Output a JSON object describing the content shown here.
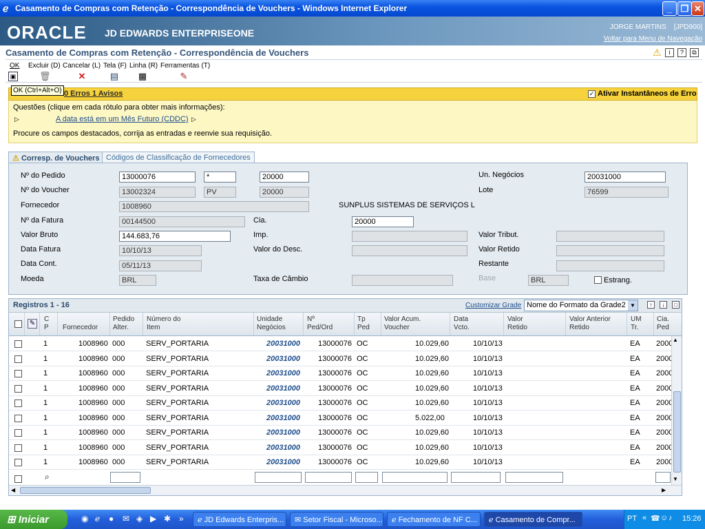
{
  "window": {
    "title": "Casamento de Compras com Retenção - Correspondência de Vouchers - Windows Internet Explorer"
  },
  "header": {
    "brand": "ORACLE",
    "product": "JD EDWARDS ENTERPRISEONE",
    "user": "JORGE MARTINS",
    "env": "[JPD900]",
    "back_link": "Voltar para Menu de Navegação"
  },
  "form": {
    "title": "Casamento de Compras com Retenção - Correspondência de Vouchers"
  },
  "toolbar": {
    "ok": "OK",
    "excluir": "Excluir (D)",
    "cancelar": "Cancelar (L)",
    "tela": "Tela (F)",
    "linha": "Linha (R)",
    "ferramentas": "Ferramentas (T)",
    "tooltip": "OK (Ctrl+Alt+O)"
  },
  "errors": {
    "summary": "0 Erros 1 Avisos",
    "toggle_label": "Ativar Instantâneos de Erro",
    "questions": "Questões (clique em cada rótulo para obter mais informações):",
    "warning_link": "A data está em um Mês Futuro (CDDC)",
    "instruction": "Procure os campos destacados, corrija as entradas e reenvie sua requisição."
  },
  "tabs": [
    {
      "label": "Corresp. de Vouchers"
    },
    {
      "label": "Códigos de Classificação de Fornecedores"
    }
  ],
  "fields": {
    "pedido_label": "Nº do Pedido",
    "pedido_num": "13000076",
    "pedido_tipo": "*",
    "pedido_cia": "20000",
    "voucher_label": "Nº do Voucher",
    "voucher_num": "13002324",
    "voucher_tipo": "PV",
    "voucher_cia": "20000",
    "fornecedor_label": "Fornecedor",
    "fornecedor": "1008960",
    "fornecedor_nome": "SUNPLUS SISTEMAS DE SERVIÇOS L",
    "fatura_label": "Nº da Fatura",
    "fatura": "00144500",
    "cia_label": "Cia.",
    "cia": "20000",
    "valor_bruto_label": "Valor Bruto",
    "valor_bruto": "144.683,76",
    "imp_label": "Imp.",
    "data_fatura_label": "Data Fatura",
    "data_fatura": "10/10/13",
    "valor_desc_label": "Valor do Desc.",
    "data_cont_label": "Data Cont.",
    "data_cont": "05/11/13",
    "moeda_label": "Moeda",
    "moeda": "BRL",
    "taxa_label": "Taxa de Câmbio",
    "un_negocios_label": "Un. Negócios",
    "un_negocios": "20031000",
    "lote_label": "Lote",
    "lote": "76599",
    "valor_tribut_label": "Valor Tribut.",
    "valor_retido_label": "Valor Retido",
    "restante_label": "Restante",
    "base_label": "Base",
    "base": "BRL",
    "estrang_label": "Estrang."
  },
  "grid": {
    "records": "Registros 1 - 16",
    "customize": "Customizar Grade",
    "format": "Nome do Formato da Grade2",
    "columns": [
      "C\nP",
      "Fornecedor",
      "Pedido\nAlter.",
      "Número do\nItem",
      "Unidade\nNegócios",
      "Nº\nPed/Ord",
      "Tp\nPed",
      "Valor Acum.\nVoucher",
      "Data\nVcto.",
      "Valor\nRetido",
      "Valor Anterior\nRetido",
      "UM\nTr.",
      "Cia.\nPed"
    ],
    "rows": [
      {
        "cp": "1",
        "fornecedor": "1008960",
        "pedido_alter": "000",
        "item": "SERV_PORTARIA",
        "unidade": "20031000",
        "ped_ord": "13000076",
        "tp": "OC",
        "valor": "10.029,60",
        "data": "10/10/13",
        "um": "EA",
        "cia": "2000"
      },
      {
        "cp": "1",
        "fornecedor": "1008960",
        "pedido_alter": "000",
        "item": "SERV_PORTARIA",
        "unidade": "20031000",
        "ped_ord": "13000076",
        "tp": "OC",
        "valor": "10.029,60",
        "data": "10/10/13",
        "um": "EA",
        "cia": "2000"
      },
      {
        "cp": "1",
        "fornecedor": "1008960",
        "pedido_alter": "000",
        "item": "SERV_PORTARIA",
        "unidade": "20031000",
        "ped_ord": "13000076",
        "tp": "OC",
        "valor": "10.029,60",
        "data": "10/10/13",
        "um": "EA",
        "cia": "2000"
      },
      {
        "cp": "1",
        "fornecedor": "1008960",
        "pedido_alter": "000",
        "item": "SERV_PORTARIA",
        "unidade": "20031000",
        "ped_ord": "13000076",
        "tp": "OC",
        "valor": "10.029,60",
        "data": "10/10/13",
        "um": "EA",
        "cia": "2000"
      },
      {
        "cp": "1",
        "fornecedor": "1008960",
        "pedido_alter": "000",
        "item": "SERV_PORTARIA",
        "unidade": "20031000",
        "ped_ord": "13000076",
        "tp": "OC",
        "valor": "10.029,60",
        "data": "10/10/13",
        "um": "EA",
        "cia": "2000"
      },
      {
        "cp": "1",
        "fornecedor": "1008960",
        "pedido_alter": "000",
        "item": "SERV_PORTARIA",
        "unidade": "20031000",
        "ped_ord": "13000076",
        "tp": "OC",
        "valor": "5.022,00",
        "data": "10/10/13",
        "um": "EA",
        "cia": "2000"
      },
      {
        "cp": "1",
        "fornecedor": "1008960",
        "pedido_alter": "000",
        "item": "SERV_PORTARIA",
        "unidade": "20031000",
        "ped_ord": "13000076",
        "tp": "OC",
        "valor": "10.029,60",
        "data": "10/10/13",
        "um": "EA",
        "cia": "2000"
      },
      {
        "cp": "1",
        "fornecedor": "1008960",
        "pedido_alter": "000",
        "item": "SERV_PORTARIA",
        "unidade": "20031000",
        "ped_ord": "13000076",
        "tp": "OC",
        "valor": "10.029,60",
        "data": "10/10/13",
        "um": "EA",
        "cia": "2000"
      },
      {
        "cp": "1",
        "fornecedor": "1008960",
        "pedido_alter": "000",
        "item": "SERV_PORTARIA",
        "unidade": "20031000",
        "ped_ord": "13000076",
        "tp": "OC",
        "valor": "10.029,60",
        "data": "10/10/13",
        "um": "EA",
        "cia": "2000"
      }
    ]
  },
  "taskbar": {
    "start": "Iniciar",
    "items": [
      {
        "label": "JD Edwards Enterpris..."
      },
      {
        "label": "Setor Fiscal - Microso..."
      },
      {
        "label": "Fechamento de NF C..."
      },
      {
        "label": "Casamento de Compr..."
      }
    ],
    "lang": "PT",
    "clock": "15:26"
  },
  "colors": {
    "accent": "#35557a",
    "warning": "#f6d23c",
    "link_blue": "#1f4e8c",
    "taskbar": "#245edb"
  }
}
